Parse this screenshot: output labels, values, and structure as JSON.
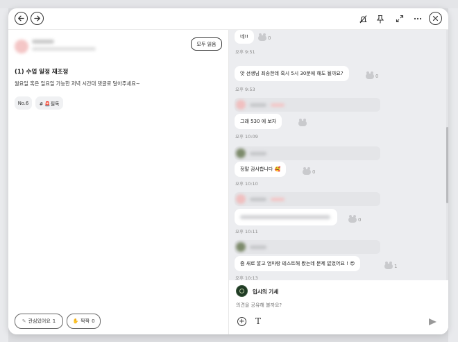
{
  "left": {
    "read_all_label": "모두 읽음",
    "post_title": "(1) 수업 일정 재조정",
    "post_body": "월요일 혹은 일요일 가능한 저녁 시간대 댓글로 달아주세요~",
    "tags": [
      "No.6",
      "# 🚨필독"
    ],
    "reactions": [
      {
        "label": "관심있어요",
        "count": "1"
      },
      {
        "label": "짝짝",
        "count": "0"
      }
    ]
  },
  "chat": {
    "messages": [
      {
        "text": "네!!",
        "reaction_count": "0",
        "time": "오후 9:51"
      },
      {
        "text": "앗 선생님 죄송한데 혹시 5시 30분에 해도 될까요?",
        "reaction_count": "0",
        "time": "오후 9:53"
      },
      {
        "text": "그래 530 에 보자",
        "reaction_count": "",
        "time": "오후 10:09"
      },
      {
        "text": "정말 감사합니다 🥰",
        "reaction_count": "0",
        "time": "오후 10:10"
      },
      {
        "text": "",
        "reaction_count": "0",
        "time": "오후 10:11"
      },
      {
        "text": "줌 새로 깔고 엄마랑 테스트해 봤는데 문제 없었어요 ! 😍",
        "reaction_count": "1",
        "time": "오후 10:13"
      }
    ]
  },
  "composer": {
    "user_name": "입시의 기세",
    "placeholder": "의견을 공유해 볼까요?"
  },
  "icons": {
    "back": "arrow-left-circle-icon",
    "forward": "arrow-right-circle-icon",
    "mute": "bell-off-icon",
    "pin": "pin-icon",
    "expand": "expand-icon",
    "more": "more-icon",
    "close": "close-circle-icon"
  }
}
